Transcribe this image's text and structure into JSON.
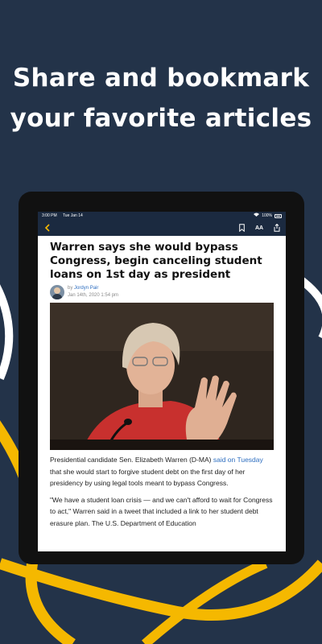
{
  "promo": {
    "line1": "Share and bookmark",
    "line2": "your favorite articles"
  },
  "status_bar": {
    "time": "3:00 PM",
    "date": "Tue Jan 14",
    "battery": "100%"
  },
  "toolbar": {
    "back_icon": "chevron-left-icon",
    "bookmark_icon": "bookmark-icon",
    "font_size_label": "AA",
    "share_icon": "share-icon"
  },
  "article": {
    "headline": "Warren says she would bypass Congress, begin canceling student loans on 1st day as president",
    "byline_prefix": "by",
    "author": "Jordyn Pair",
    "date": "Jan 14th, 2020 1:54 pm",
    "para1_before": "Presidential candidate Sen. Elizabeth Warren (D-MA) ",
    "para1_link": "said on Tuesday",
    "para1_after": " that she would start to forgive student debt on the first day of her presidency by using legal tools meant to bypass Congress.",
    "para2": "\"We have a student loan crisis — and we can't afford to wait for Congress to act,\" Warren said in a tweet that included a link to her student debt erasure plan. The U.S. Department of Education"
  },
  "colors": {
    "background": "#233349",
    "accent_yellow": "#f5b800",
    "link_blue": "#2f6fc0",
    "app_bar": "#1b2a40"
  }
}
